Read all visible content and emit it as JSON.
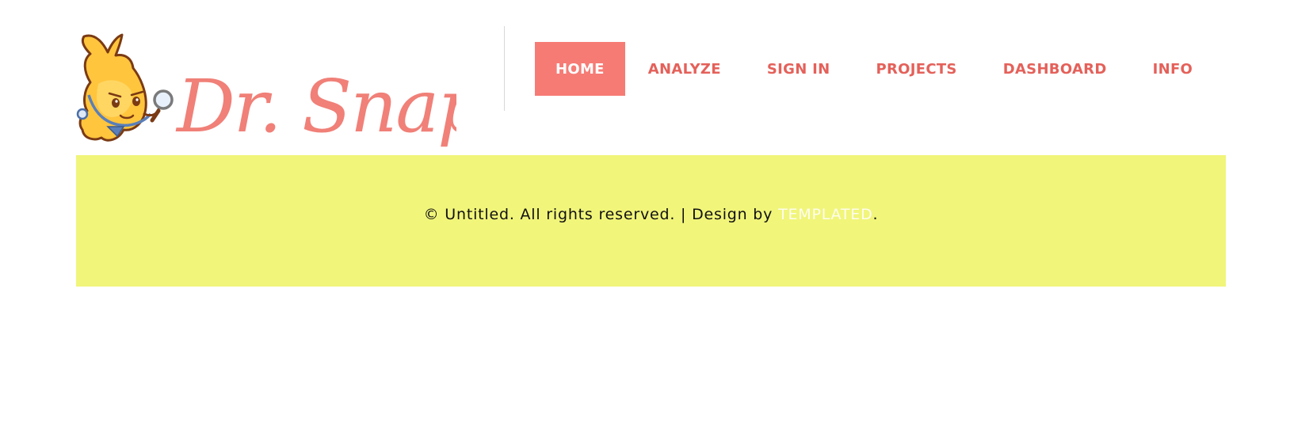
{
  "site": {
    "logo_text": "Dr. Snap!",
    "logo_alt": "Dr. Snap! mascot with magnifying glass"
  },
  "nav": {
    "items": [
      {
        "label": "HOME",
        "active": true
      },
      {
        "label": "ANALYZE",
        "active": false
      },
      {
        "label": "SIGN IN",
        "active": false
      },
      {
        "label": "PROJECTS",
        "active": false
      },
      {
        "label": "DASHBOARD",
        "active": false
      },
      {
        "label": "INFO",
        "active": false
      }
    ]
  },
  "footer": {
    "copyright_prefix": "© Untitled. All rights reserved. | Design by ",
    "credit_link": "TEMPLATED",
    "copyright_suffix": "."
  },
  "colors": {
    "accent": "#f67b75",
    "nav_text": "#e4615a",
    "footer_bg": "#f1f57a",
    "logo_text": "#f08078",
    "mascot_body": "#ffc53d",
    "mascot_outline": "#7a3a14"
  }
}
